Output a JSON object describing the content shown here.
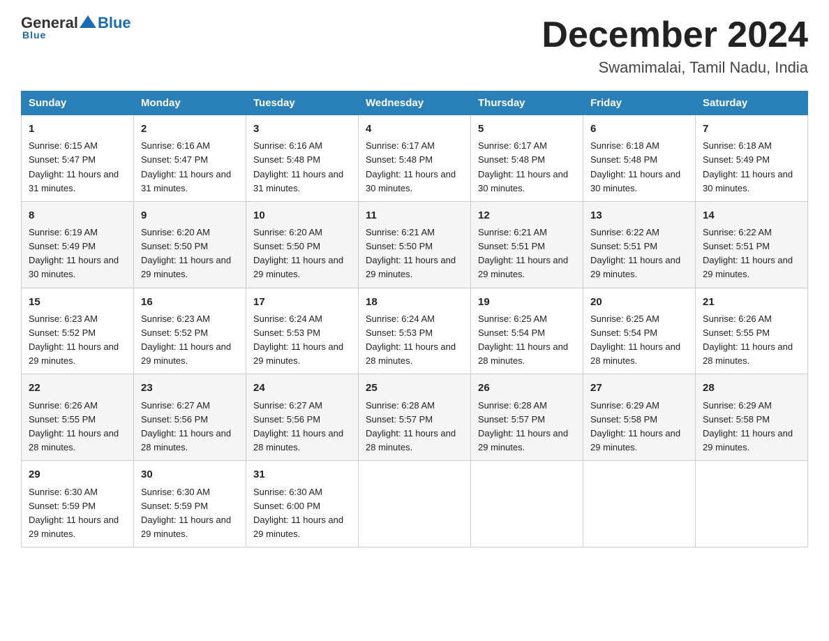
{
  "header": {
    "logo_general": "General",
    "logo_blue": "Blue",
    "month_title": "December 2024",
    "location": "Swamimalai, Tamil Nadu, India"
  },
  "weekdays": [
    "Sunday",
    "Monday",
    "Tuesday",
    "Wednesday",
    "Thursday",
    "Friday",
    "Saturday"
  ],
  "weeks": [
    [
      {
        "day": "1",
        "sunrise": "Sunrise: 6:15 AM",
        "sunset": "Sunset: 5:47 PM",
        "daylight": "Daylight: 11 hours and 31 minutes."
      },
      {
        "day": "2",
        "sunrise": "Sunrise: 6:16 AM",
        "sunset": "Sunset: 5:47 PM",
        "daylight": "Daylight: 11 hours and 31 minutes."
      },
      {
        "day": "3",
        "sunrise": "Sunrise: 6:16 AM",
        "sunset": "Sunset: 5:48 PM",
        "daylight": "Daylight: 11 hours and 31 minutes."
      },
      {
        "day": "4",
        "sunrise": "Sunrise: 6:17 AM",
        "sunset": "Sunset: 5:48 PM",
        "daylight": "Daylight: 11 hours and 30 minutes."
      },
      {
        "day": "5",
        "sunrise": "Sunrise: 6:17 AM",
        "sunset": "Sunset: 5:48 PM",
        "daylight": "Daylight: 11 hours and 30 minutes."
      },
      {
        "day": "6",
        "sunrise": "Sunrise: 6:18 AM",
        "sunset": "Sunset: 5:48 PM",
        "daylight": "Daylight: 11 hours and 30 minutes."
      },
      {
        "day": "7",
        "sunrise": "Sunrise: 6:18 AM",
        "sunset": "Sunset: 5:49 PM",
        "daylight": "Daylight: 11 hours and 30 minutes."
      }
    ],
    [
      {
        "day": "8",
        "sunrise": "Sunrise: 6:19 AM",
        "sunset": "Sunset: 5:49 PM",
        "daylight": "Daylight: 11 hours and 30 minutes."
      },
      {
        "day": "9",
        "sunrise": "Sunrise: 6:20 AM",
        "sunset": "Sunset: 5:50 PM",
        "daylight": "Daylight: 11 hours and 29 minutes."
      },
      {
        "day": "10",
        "sunrise": "Sunrise: 6:20 AM",
        "sunset": "Sunset: 5:50 PM",
        "daylight": "Daylight: 11 hours and 29 minutes."
      },
      {
        "day": "11",
        "sunrise": "Sunrise: 6:21 AM",
        "sunset": "Sunset: 5:50 PM",
        "daylight": "Daylight: 11 hours and 29 minutes."
      },
      {
        "day": "12",
        "sunrise": "Sunrise: 6:21 AM",
        "sunset": "Sunset: 5:51 PM",
        "daylight": "Daylight: 11 hours and 29 minutes."
      },
      {
        "day": "13",
        "sunrise": "Sunrise: 6:22 AM",
        "sunset": "Sunset: 5:51 PM",
        "daylight": "Daylight: 11 hours and 29 minutes."
      },
      {
        "day": "14",
        "sunrise": "Sunrise: 6:22 AM",
        "sunset": "Sunset: 5:51 PM",
        "daylight": "Daylight: 11 hours and 29 minutes."
      }
    ],
    [
      {
        "day": "15",
        "sunrise": "Sunrise: 6:23 AM",
        "sunset": "Sunset: 5:52 PM",
        "daylight": "Daylight: 11 hours and 29 minutes."
      },
      {
        "day": "16",
        "sunrise": "Sunrise: 6:23 AM",
        "sunset": "Sunset: 5:52 PM",
        "daylight": "Daylight: 11 hours and 29 minutes."
      },
      {
        "day": "17",
        "sunrise": "Sunrise: 6:24 AM",
        "sunset": "Sunset: 5:53 PM",
        "daylight": "Daylight: 11 hours and 29 minutes."
      },
      {
        "day": "18",
        "sunrise": "Sunrise: 6:24 AM",
        "sunset": "Sunset: 5:53 PM",
        "daylight": "Daylight: 11 hours and 28 minutes."
      },
      {
        "day": "19",
        "sunrise": "Sunrise: 6:25 AM",
        "sunset": "Sunset: 5:54 PM",
        "daylight": "Daylight: 11 hours and 28 minutes."
      },
      {
        "day": "20",
        "sunrise": "Sunrise: 6:25 AM",
        "sunset": "Sunset: 5:54 PM",
        "daylight": "Daylight: 11 hours and 28 minutes."
      },
      {
        "day": "21",
        "sunrise": "Sunrise: 6:26 AM",
        "sunset": "Sunset: 5:55 PM",
        "daylight": "Daylight: 11 hours and 28 minutes."
      }
    ],
    [
      {
        "day": "22",
        "sunrise": "Sunrise: 6:26 AM",
        "sunset": "Sunset: 5:55 PM",
        "daylight": "Daylight: 11 hours and 28 minutes."
      },
      {
        "day": "23",
        "sunrise": "Sunrise: 6:27 AM",
        "sunset": "Sunset: 5:56 PM",
        "daylight": "Daylight: 11 hours and 28 minutes."
      },
      {
        "day": "24",
        "sunrise": "Sunrise: 6:27 AM",
        "sunset": "Sunset: 5:56 PM",
        "daylight": "Daylight: 11 hours and 28 minutes."
      },
      {
        "day": "25",
        "sunrise": "Sunrise: 6:28 AM",
        "sunset": "Sunset: 5:57 PM",
        "daylight": "Daylight: 11 hours and 28 minutes."
      },
      {
        "day": "26",
        "sunrise": "Sunrise: 6:28 AM",
        "sunset": "Sunset: 5:57 PM",
        "daylight": "Daylight: 11 hours and 29 minutes."
      },
      {
        "day": "27",
        "sunrise": "Sunrise: 6:29 AM",
        "sunset": "Sunset: 5:58 PM",
        "daylight": "Daylight: 11 hours and 29 minutes."
      },
      {
        "day": "28",
        "sunrise": "Sunrise: 6:29 AM",
        "sunset": "Sunset: 5:58 PM",
        "daylight": "Daylight: 11 hours and 29 minutes."
      }
    ],
    [
      {
        "day": "29",
        "sunrise": "Sunrise: 6:30 AM",
        "sunset": "Sunset: 5:59 PM",
        "daylight": "Daylight: 11 hours and 29 minutes."
      },
      {
        "day": "30",
        "sunrise": "Sunrise: 6:30 AM",
        "sunset": "Sunset: 5:59 PM",
        "daylight": "Daylight: 11 hours and 29 minutes."
      },
      {
        "day": "31",
        "sunrise": "Sunrise: 6:30 AM",
        "sunset": "Sunset: 6:00 PM",
        "daylight": "Daylight: 11 hours and 29 minutes."
      },
      {
        "day": "",
        "sunrise": "",
        "sunset": "",
        "daylight": ""
      },
      {
        "day": "",
        "sunrise": "",
        "sunset": "",
        "daylight": ""
      },
      {
        "day": "",
        "sunrise": "",
        "sunset": "",
        "daylight": ""
      },
      {
        "day": "",
        "sunrise": "",
        "sunset": "",
        "daylight": ""
      }
    ]
  ]
}
